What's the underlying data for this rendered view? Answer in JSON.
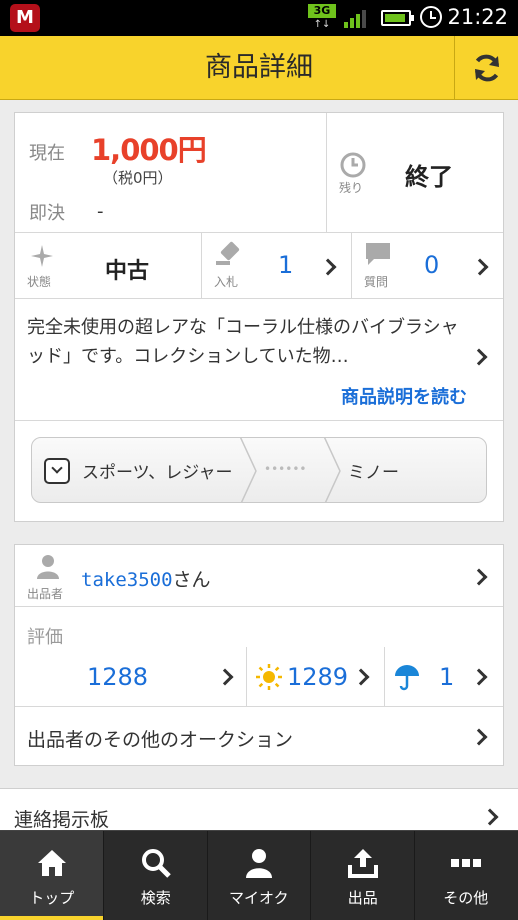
{
  "status_bar": {
    "app_icon_letter": "M",
    "network": "3G",
    "time": "21:22"
  },
  "header": {
    "title": "商品詳細"
  },
  "summary": {
    "current_label": "現在",
    "current_price": "1,000円",
    "tax_note": "（税0円）",
    "buyout_label": "即決",
    "buyout_value": "-",
    "remaining_label": "残り",
    "remaining_value": "終了",
    "condition_label": "状態",
    "condition_value": "中古",
    "bids_label": "入札",
    "bids_value": "1",
    "questions_label": "質問",
    "questions_value": "0"
  },
  "description": {
    "text": "完全未使用の超レアな「コーラル仕様のバイブラシャッド」です。コレクションしていた物…",
    "read_link": "商品説明を読む"
  },
  "breadcrumb": {
    "items": [
      "スポーツ、レジャー",
      "••••••",
      "ミノー"
    ]
  },
  "seller": {
    "label": "出品者",
    "name": "take3500",
    "suffix": "さん",
    "rating_label": "評価",
    "rating_total": "1288",
    "rating_good": "1289",
    "rating_bad": "1",
    "other_auctions": "出品者のその他のオークション"
  },
  "board": {
    "label": "連絡掲示板"
  },
  "tabs": [
    {
      "label": "トップ",
      "icon": "home-icon",
      "active": true
    },
    {
      "label": "検索",
      "icon": "search-icon",
      "active": false
    },
    {
      "label": "マイオク",
      "icon": "person-icon",
      "active": false
    },
    {
      "label": "出品",
      "icon": "upload-icon",
      "active": false
    },
    {
      "label": "その他",
      "icon": "more-icon",
      "active": false
    }
  ],
  "colors": {
    "header_bg": "#f8d32c",
    "price": "#e8412a",
    "link": "#1a6ed8",
    "good_rating_icon": "#f5b800",
    "bad_rating_icon": "#1a86d8",
    "tabbar_bg": "#2a2a2a"
  }
}
